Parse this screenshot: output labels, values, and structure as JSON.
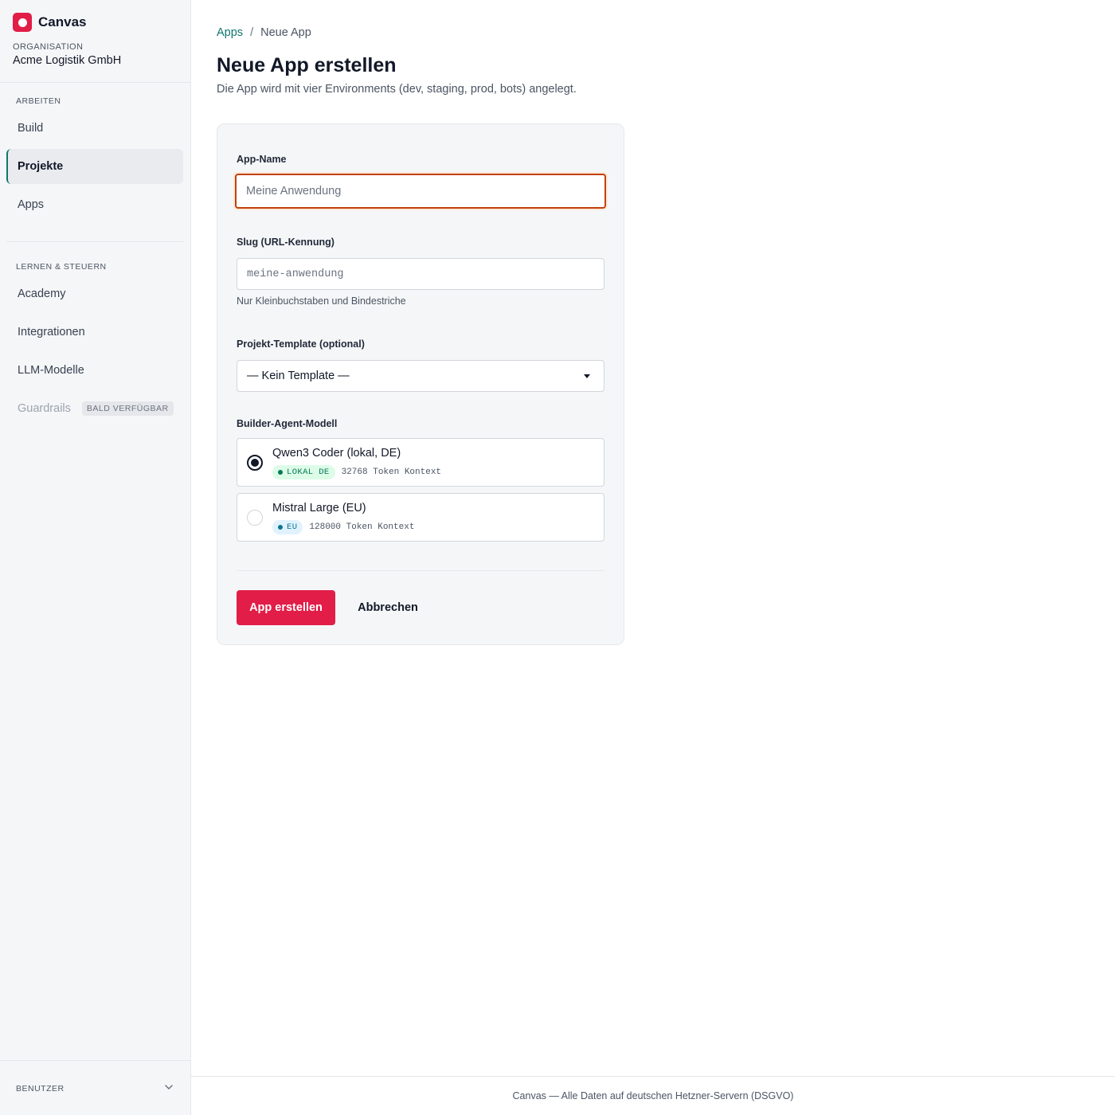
{
  "brand": {
    "name": "Canvas",
    "accent": "#e11d48"
  },
  "org": {
    "label": "ORGANISATION",
    "name": "Acme Logistik GmbH"
  },
  "sidebar": {
    "sections": [
      {
        "title": "ARBEITEN",
        "items": [
          {
            "label": "Build"
          },
          {
            "label": "Projekte",
            "active": true
          },
          {
            "label": "Apps"
          }
        ]
      },
      {
        "title": "LERNEN & STEUERN",
        "items": [
          {
            "label": "Academy"
          },
          {
            "label": "Integrationen"
          },
          {
            "label": "LLM-Modelle"
          },
          {
            "label": "Guardrails",
            "badge": "BALD VERFÜGBAR",
            "disabled": true
          }
        ]
      }
    ],
    "user": {
      "label": "BENUTZER",
      "icon": "chevron-down-icon"
    }
  },
  "breadcrumb": {
    "parent": "Apps",
    "separator": "/",
    "current": "Neue App"
  },
  "page": {
    "title": "Neue App erstellen",
    "subtitle": "Die App wird mit vier Environments (dev, staging, prod, bots) angelegt."
  },
  "form": {
    "name": {
      "label": "App-Name",
      "value": "",
      "placeholder": "Meine Anwendung"
    },
    "slug": {
      "label": "Slug (URL-Kennung)",
      "value": "",
      "placeholder": "meine-anwendung",
      "hint": "Nur Kleinbuchstaben und Bindestriche"
    },
    "template": {
      "label": "Projekt-Template (optional)",
      "selected": "— Kein Template —"
    },
    "model": {
      "label": "Builder-Agent-Modell",
      "options": [
        {
          "title": "Qwen3 Coder (lokal, DE)",
          "tag": "LOKAL DE",
          "context": "32768 Token Kontext",
          "selected": true
        },
        {
          "title": "Mistral Large (EU)",
          "tag": "EU",
          "context": "128000 Token Kontext",
          "selected": false
        }
      ]
    },
    "submit_label": "App erstellen",
    "cancel_label": "Abbrechen"
  },
  "footer": {
    "text": "Canvas — Alle Daten auf deutschen Hetzner-Servern (DSGVO)"
  }
}
